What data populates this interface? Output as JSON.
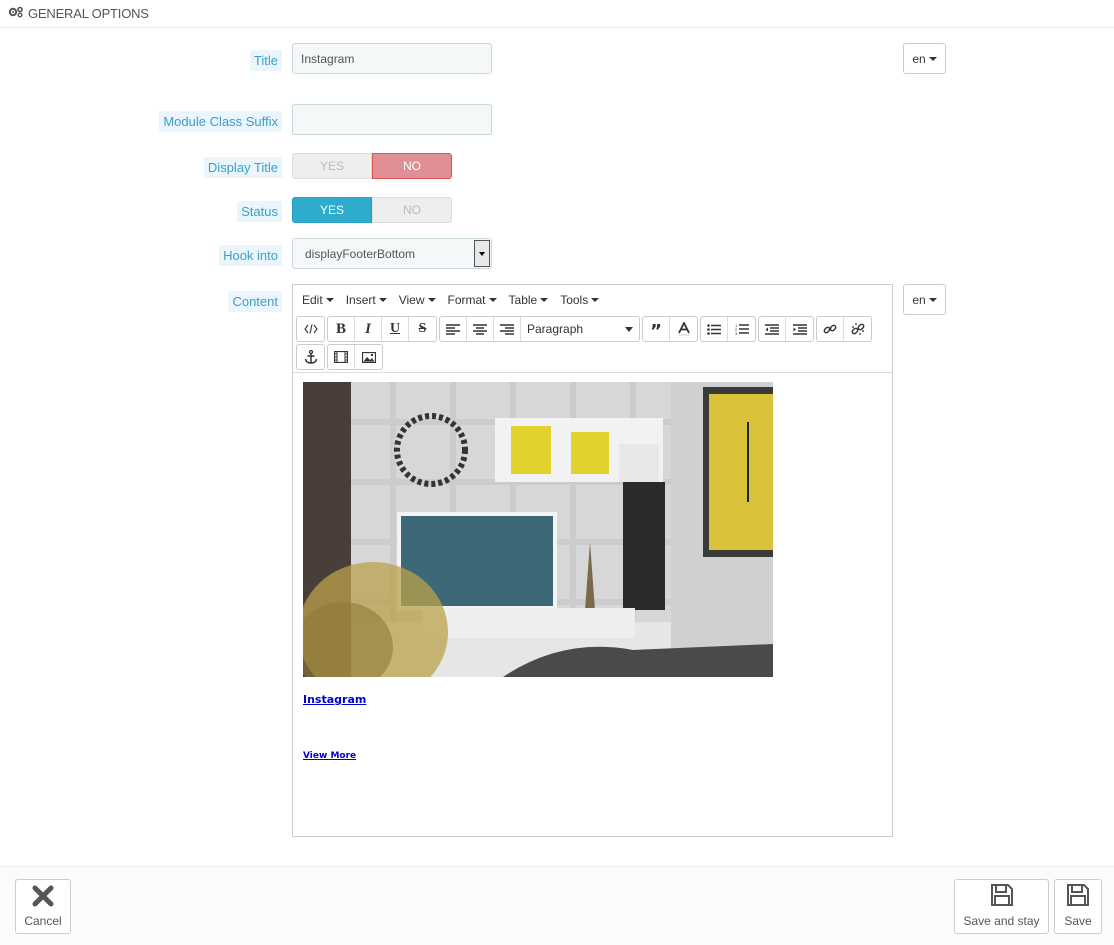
{
  "panel": {
    "title": "GENERAL OPTIONS",
    "icon": "gears-icon"
  },
  "form": {
    "title_label": "Title",
    "title_value": "Instagram",
    "suffix_label": "Module Class Suffix",
    "suffix_value": "",
    "display_title_label": "Display Title",
    "display_title": {
      "yes": "YES",
      "no": "NO",
      "selected": "NO"
    },
    "status_label": "Status",
    "status": {
      "yes": "YES",
      "no": "NO",
      "selected": "YES"
    },
    "hook_label": "Hook into",
    "hook_value": "displayFooterBottom",
    "content_label": "Content",
    "lang": "en"
  },
  "editor": {
    "menu": [
      "Edit",
      "Insert",
      "View",
      "Format",
      "Table",
      "Tools"
    ],
    "block_format": "Paragraph",
    "content_title": "Instagram",
    "content_more": "View More"
  },
  "footer": {
    "cancel": "Cancel",
    "save_and_stay": "Save and stay",
    "save": "Save"
  },
  "colors": {
    "label": "#3aa0c8",
    "label_bg": "#eaf6fb",
    "switch_yes": "#2eacce",
    "switch_no": "#e08f95",
    "link": "#0000cc"
  }
}
